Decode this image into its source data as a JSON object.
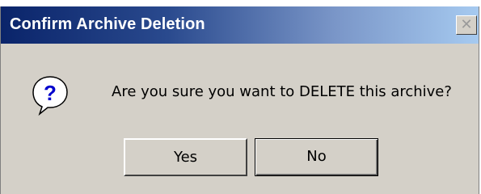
{
  "dialog": {
    "title": "Confirm Archive Deletion",
    "close_glyph": "✕",
    "icon": "question-icon",
    "message": "Are you sure you want to DELETE this archive?",
    "buttons": {
      "yes_label": "Yes",
      "no_label": "No"
    }
  },
  "colors": {
    "titlebar_start": "#0a246a",
    "titlebar_end": "#a6caf0",
    "dialog_background": "#d4d0c8"
  }
}
